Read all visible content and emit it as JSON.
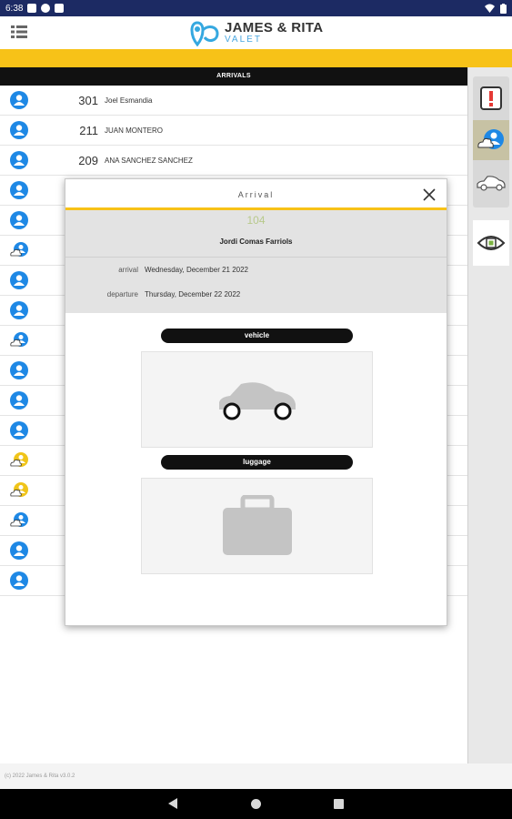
{
  "status_bar": {
    "time": "6:38"
  },
  "app": {
    "logo_title": "JAMES & RITA",
    "logo_sub": "VALET"
  },
  "arrivals": {
    "header": "ARRIVALS",
    "rows": [
      {
        "room": "301",
        "name": "Joel Esmandia",
        "icon": "user-icon",
        "color": "#1e88e5"
      },
      {
        "room": "211",
        "name": "JUAN MONTERO",
        "icon": "user-icon",
        "color": "#1e88e5"
      },
      {
        "room": "209",
        "name": "ANA SANCHEZ SANCHEZ",
        "icon": "user-icon",
        "color": "#1e88e5"
      },
      {
        "room": "",
        "name": "",
        "icon": "user-icon",
        "color": "#1e88e5"
      },
      {
        "room": "",
        "name": "",
        "icon": "user-icon",
        "color": "#1e88e5"
      },
      {
        "room": "",
        "name": "",
        "icon": "user-cloud-icon",
        "color": "#1e88e5"
      },
      {
        "room": "",
        "name": "",
        "icon": "user-icon",
        "color": "#1e88e5"
      },
      {
        "room": "",
        "name": "",
        "icon": "user-icon",
        "color": "#1e88e5"
      },
      {
        "room": "",
        "name": "",
        "icon": "user-cloud-icon",
        "color": "#1e88e5"
      },
      {
        "room": "",
        "name": "",
        "icon": "user-icon",
        "color": "#1e88e5"
      },
      {
        "room": "",
        "name": "",
        "icon": "user-icon",
        "color": "#1e88e5"
      },
      {
        "room": "",
        "name": "",
        "icon": "user-icon",
        "color": "#1e88e5"
      },
      {
        "room": "",
        "name": "",
        "icon": "user-cloud-icon",
        "color": "#f0c419"
      },
      {
        "room": "",
        "name": "",
        "icon": "user-cloud-icon",
        "color": "#f0c419"
      },
      {
        "room": "",
        "name": "",
        "icon": "user-cloud-icon",
        "color": "#1e88e5"
      },
      {
        "room": "",
        "name": "",
        "icon": "user-icon",
        "color": "#1e88e5"
      },
      {
        "room": "",
        "name": "",
        "icon": "user-icon",
        "color": "#1e88e5"
      }
    ]
  },
  "modal": {
    "title": "Arrival",
    "room": "104",
    "guest": "Jordi Comas Farriols",
    "arrival_label": "arrival",
    "arrival_value": "Wednesday, December 21 2022",
    "departure_label": "departure",
    "departure_value": "Thursday, December 22 2022",
    "vehicle_label": "vehicle",
    "luggage_label": "luggage"
  },
  "footer": {
    "text": "(c) 2022 James & Rita v3.0.2"
  },
  "colors": {
    "accent": "#f7c218",
    "brand_blue": "#1e88e5",
    "status_bar": "#1c2a63"
  }
}
